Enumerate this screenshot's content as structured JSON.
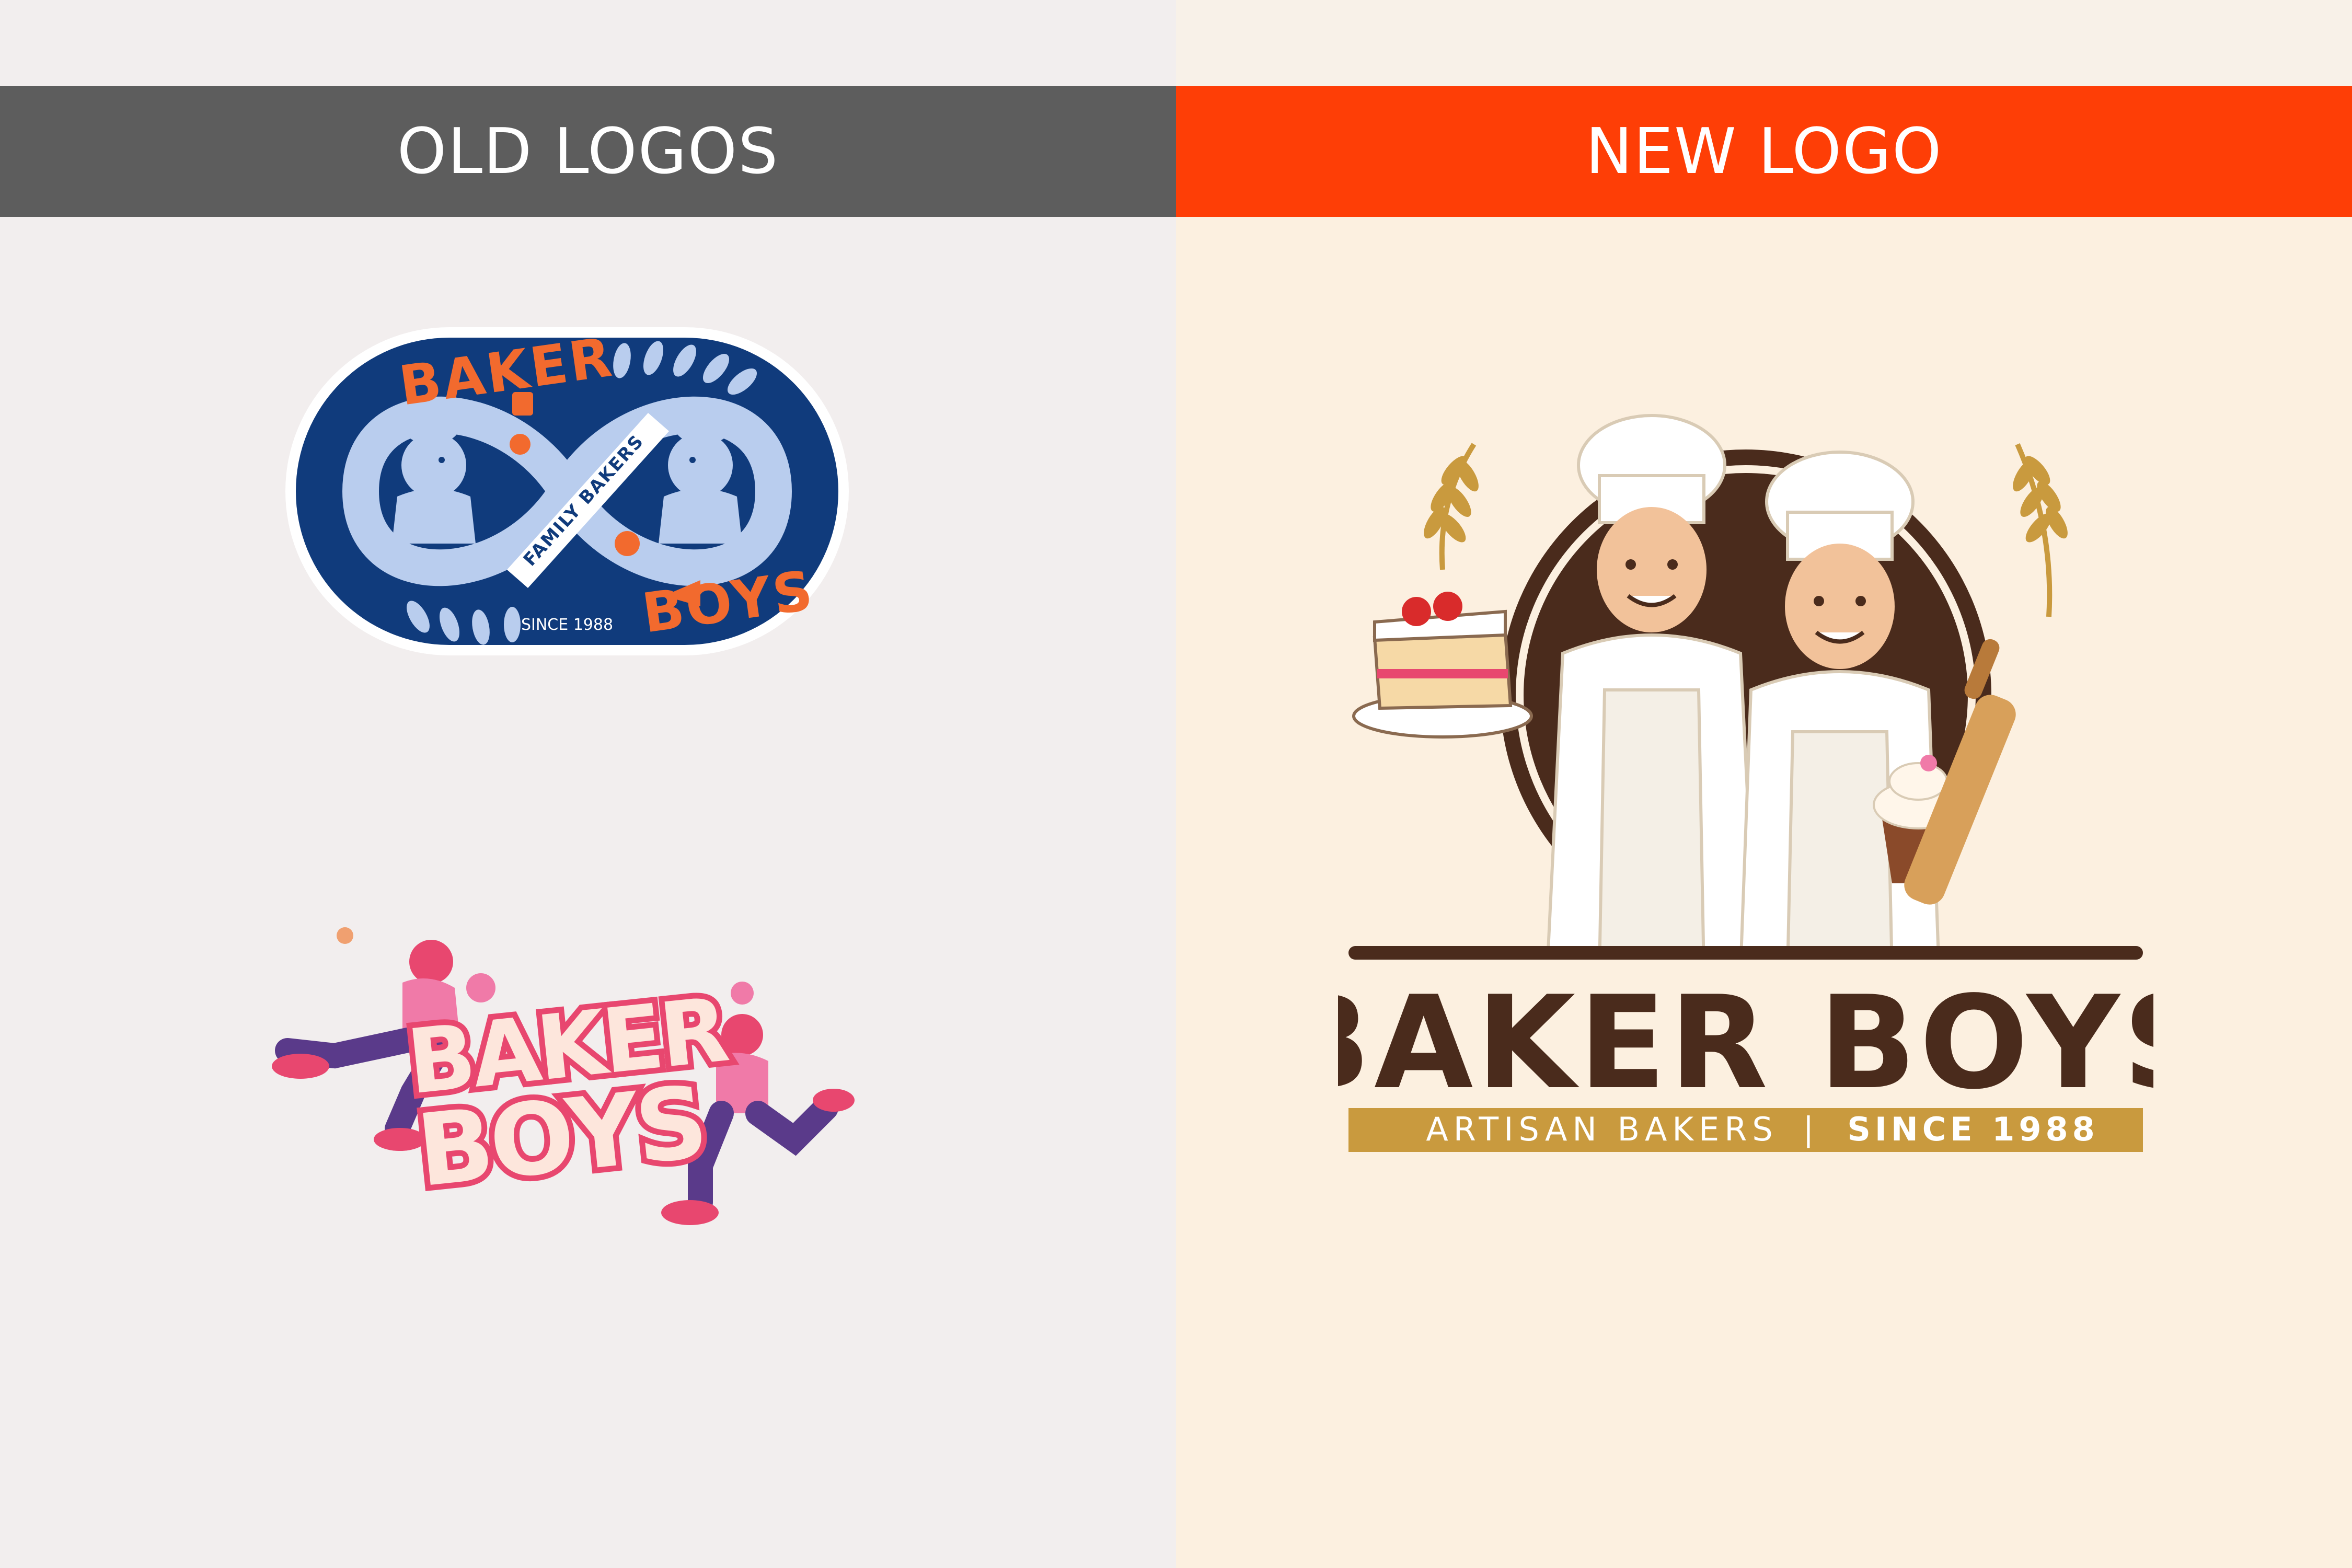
{
  "old_section": {
    "heading": "OLD LOGOS",
    "logo_1": {
      "top_word": "BAKER",
      "bottom_word": "BOYS",
      "ribbon": "FAMILY BAKERS",
      "since": "SINCE 1988"
    },
    "logo_2": {
      "line_1": "BAKER",
      "line_2": "BOYS"
    }
  },
  "new_section": {
    "heading": "NEW LOGO",
    "wordmark": "BAKER BOYS",
    "tagline_left": "ARTISAN BAKERS",
    "tagline_divider": "|",
    "tagline_right": "SINCE 1988"
  },
  "colors": {
    "old_banner": "#5d5d5d",
    "new_banner": "#fe3e06",
    "navy": "#103b7c",
    "orange": "#f26a2e",
    "pink": "#f07aa8",
    "brown": "#4a2b1c",
    "gold": "#c99a3e"
  }
}
